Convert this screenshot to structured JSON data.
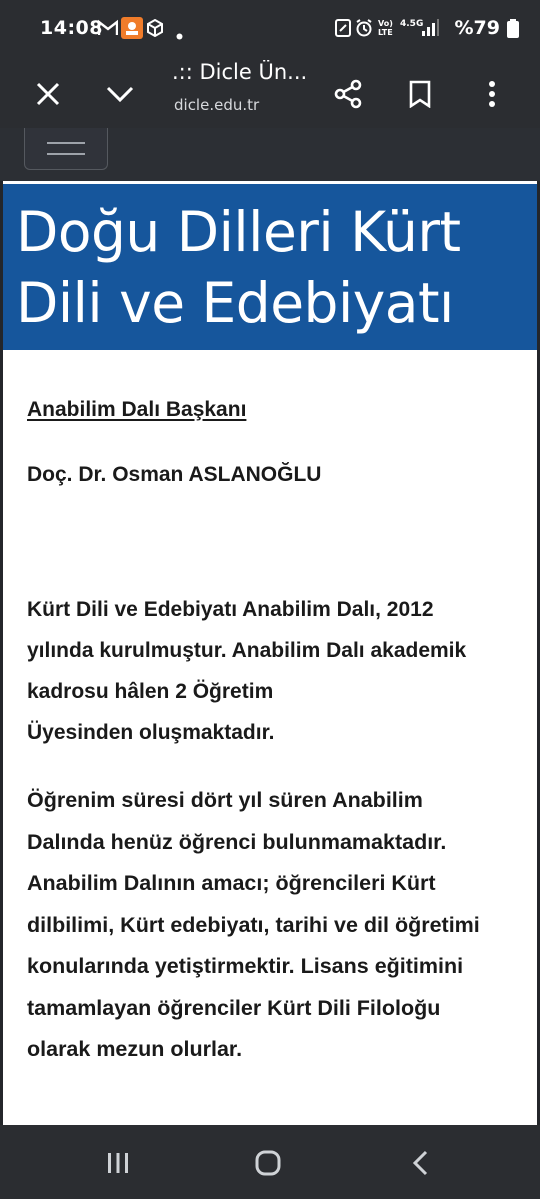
{
  "status_bar": {
    "time": "14:08",
    "network": "4.5G",
    "network_sub": "Vo) LTE",
    "battery": "%79"
  },
  "browser": {
    "page_title": ".:: Dicle Ün...",
    "url": "dicle.edu.tr"
  },
  "page": {
    "title": "Doğu Dilleri Kürt Dili ve Edebiyatı",
    "head_label": "Anabilim Dalı Başkanı",
    "head_name": "Doç. Dr. Osman ASLANOĞLU",
    "paragraph1_lines": [
      "Kürt Dili ve Edebiyatı Anabilim Dalı, 2012",
      "yılında kurulmuştur. Anabilim Dalı akademik",
      "kadrosu hâlen 2 Öğretim",
      "Üyesinden oluşmaktadır."
    ],
    "paragraph2_lines": [
      "Öğrenim süresi dört yıl süren Anabilim",
      "Dalında henüz öğrenci bulunmamaktadır.",
      "Anabilim Dalının amacı; öğrencileri Kürt",
      "dilbilimi, Kürt edebiyatı, tarihi ve dil öğretimi",
      "konularında yetiştirmektir. Lisans eğitimini",
      "tamamlayan öğrenciler Kürt Dili Filoloğu",
      "olarak mezun olurlar."
    ]
  },
  "colors": {
    "banner": "#16569c",
    "chrome": "#2b2d31"
  },
  "icons": [
    "close-icon",
    "chevron-down-icon",
    "share-icon",
    "bookmark-icon",
    "more-vert-icon",
    "recent-apps-icon",
    "home-icon",
    "back-icon"
  ]
}
